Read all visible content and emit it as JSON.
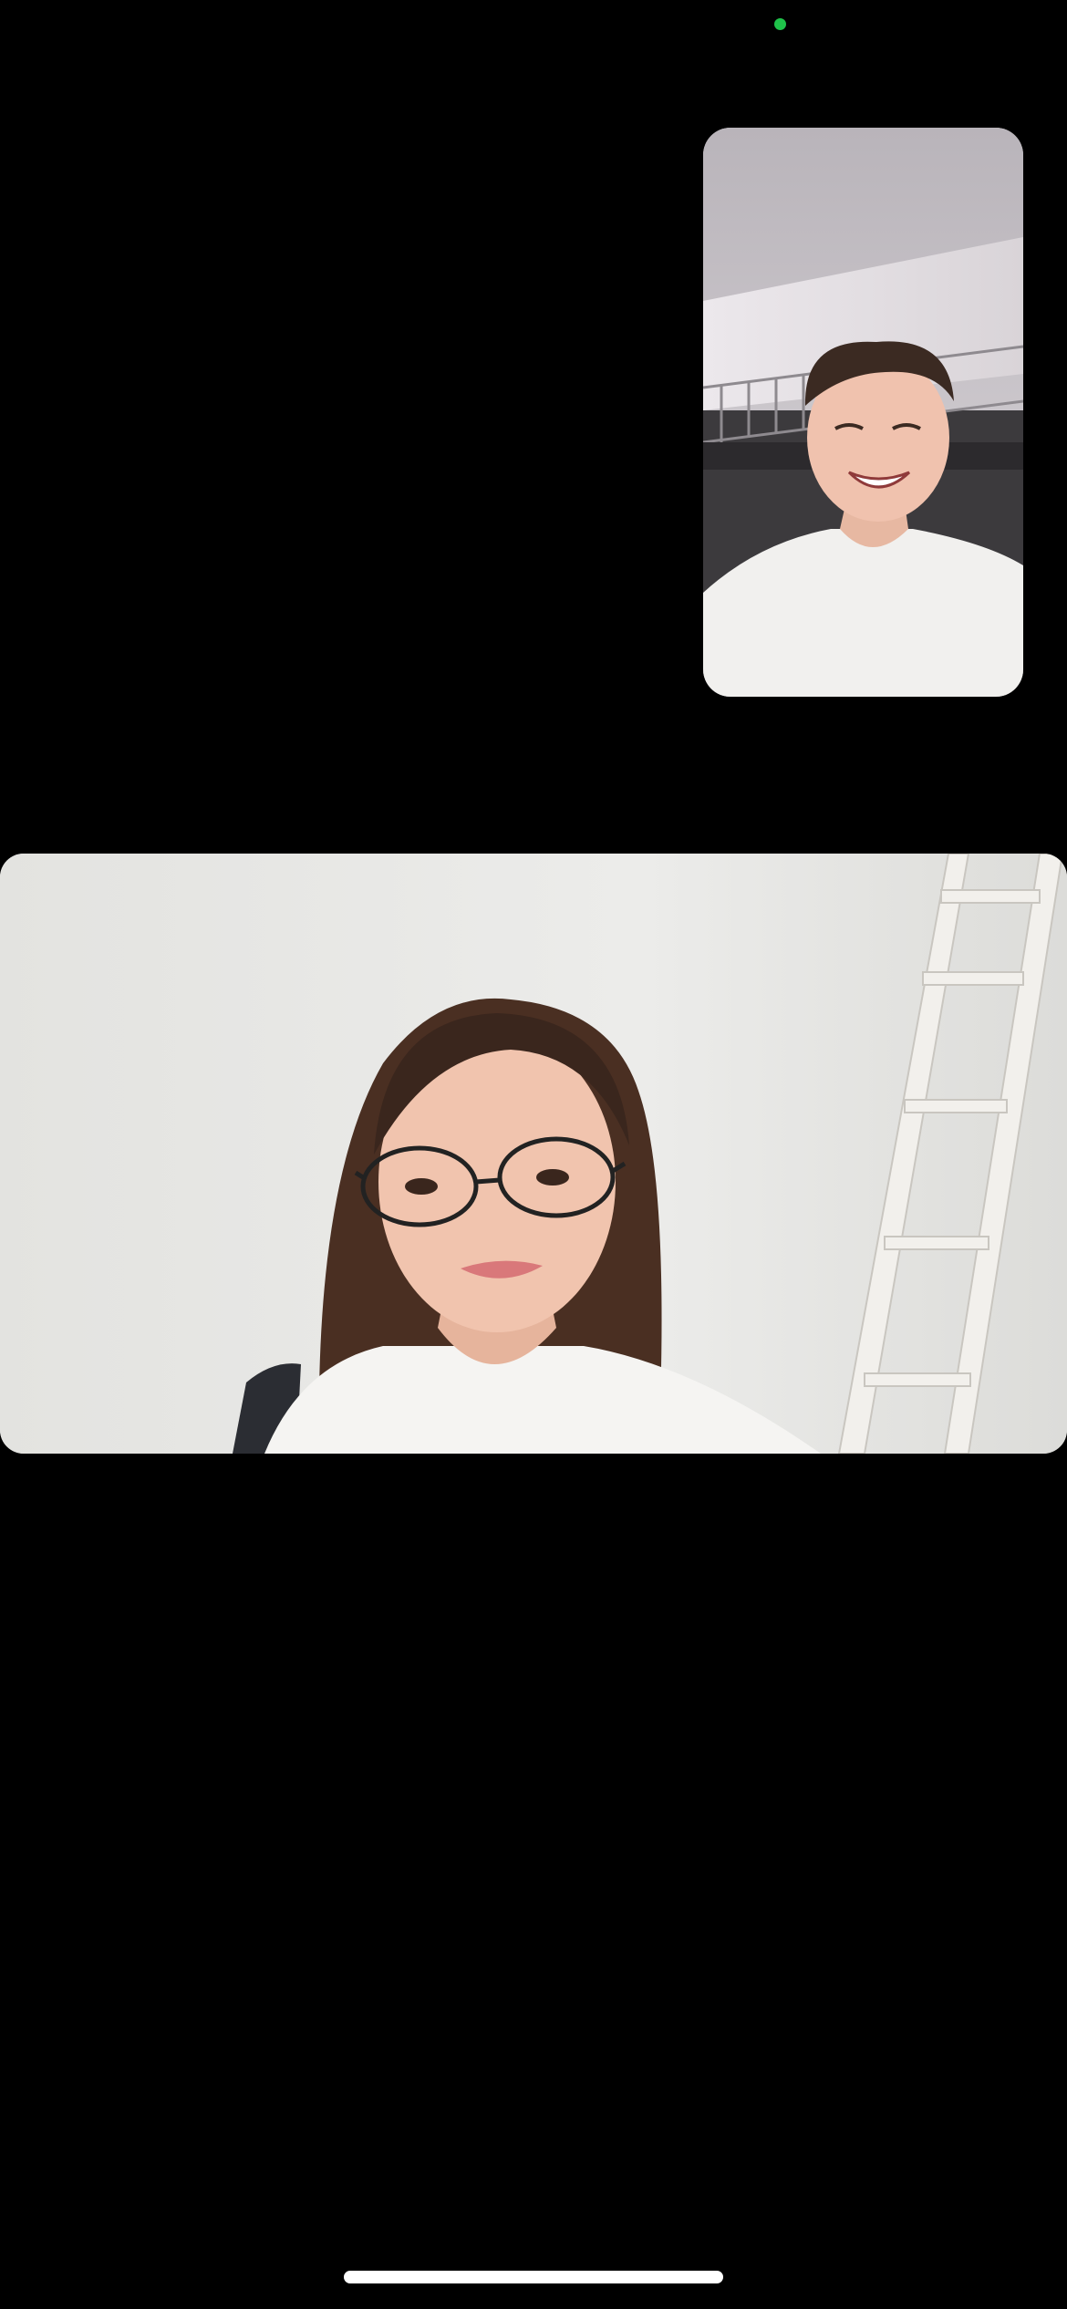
{
  "status": {
    "camera_indicator_color": "#1fc24a",
    "camera_indicator_icon": "green-dot-icon"
  },
  "call": {
    "self_view": {
      "kind": "video-feed",
      "subject": "self-camera-preview"
    },
    "remote_view": {
      "kind": "video-feed",
      "subject": "remote-participant"
    }
  },
  "system": {
    "home_indicator_color": "#ffffff"
  }
}
